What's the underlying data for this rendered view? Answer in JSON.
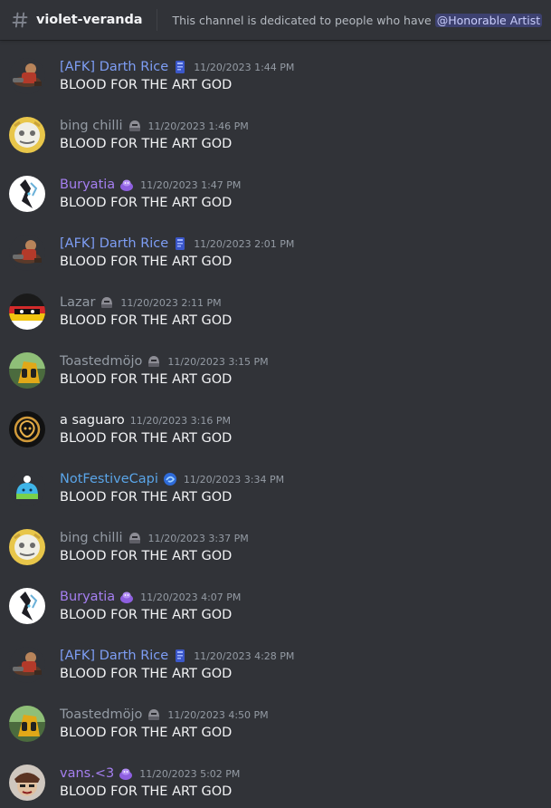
{
  "channel": {
    "name": "violet-veranda",
    "topic_prefix": "This channel is dedicated to people who have ",
    "topic_mention": "@Honorable Artist"
  },
  "colors": {
    "blue": "#7e9ef5",
    "gray": "#949ba4",
    "purple": "#a57ff0",
    "white": "#f2f3f5",
    "teal": "#5aa5e8"
  },
  "messages": [
    {
      "author": "[AFK] Darth Rice",
      "color": "#7e9ef5",
      "role_icon": "blue-book-icon",
      "avatar": "darth-rice-avatar",
      "timestamp": "11/20/2023 1:44 PM",
      "text": "BLOOD FOR THE ART GOD"
    },
    {
      "author": "bing chilli",
      "color": "#949ba4",
      "role_icon": "gray-helmet-icon",
      "avatar": "bing-chilli-avatar",
      "timestamp": "11/20/2023 1:46 PM",
      "text": "BLOOD FOR THE ART GOD"
    },
    {
      "author": "Buryatia",
      "color": "#a57ff0",
      "role_icon": "purple-blob-icon",
      "avatar": "buryatia-avatar",
      "timestamp": "11/20/2023 1:47 PM",
      "text": "BLOOD FOR THE ART GOD"
    },
    {
      "author": "[AFK] Darth Rice",
      "color": "#7e9ef5",
      "role_icon": "blue-book-icon",
      "avatar": "darth-rice-avatar",
      "timestamp": "11/20/2023 2:01 PM",
      "text": "BLOOD FOR THE ART GOD"
    },
    {
      "author": "Lazar",
      "color": "#949ba4",
      "role_icon": "gray-helmet-icon",
      "avatar": "lazar-avatar",
      "timestamp": "11/20/2023 2:11 PM",
      "text": "BLOOD FOR THE ART GOD"
    },
    {
      "author": "Toastedmöjo",
      "color": "#949ba4",
      "role_icon": "gray-helmet-icon",
      "avatar": "toastedmojo-avatar",
      "timestamp": "11/20/2023 3:15 PM",
      "text": "BLOOD FOR THE ART GOD"
    },
    {
      "author": "a saguaro",
      "color": "#f2f3f5",
      "role_icon": "",
      "avatar": "saguaro-avatar",
      "timestamp": "11/20/2023 3:16 PM",
      "text": "BLOOD FOR THE ART GOD"
    },
    {
      "author": "NotFestiveCapi",
      "color": "#5aa5e8",
      "role_icon": "blue-swirl-icon",
      "avatar": "capi-avatar",
      "timestamp": "11/20/2023 3:34 PM",
      "text": "BLOOD FOR THE ART GOD"
    },
    {
      "author": "bing chilli",
      "color": "#949ba4",
      "role_icon": "gray-helmet-icon",
      "avatar": "bing-chilli-avatar",
      "timestamp": "11/20/2023 3:37 PM",
      "text": "BLOOD FOR THE ART GOD"
    },
    {
      "author": "Buryatia",
      "color": "#a57ff0",
      "role_icon": "purple-blob-icon",
      "avatar": "buryatia-avatar",
      "timestamp": "11/20/2023 4:07 PM",
      "text": "BLOOD FOR THE ART GOD"
    },
    {
      "author": "[AFK] Darth Rice",
      "color": "#7e9ef5",
      "role_icon": "blue-book-icon",
      "avatar": "darth-rice-avatar",
      "timestamp": "11/20/2023 4:28 PM",
      "text": "BLOOD FOR THE ART GOD"
    },
    {
      "author": "Toastedmöjo",
      "color": "#949ba4",
      "role_icon": "gray-helmet-icon",
      "avatar": "toastedmojo-avatar",
      "timestamp": "11/20/2023 4:50 PM",
      "text": "BLOOD FOR THE ART GOD"
    },
    {
      "author": "vans.<3",
      "color": "#a57ff0",
      "role_icon": "purple-blob-icon",
      "avatar": "vans-avatar",
      "timestamp": "11/20/2023 5:02 PM",
      "text": "BLOOD FOR THE ART GOD"
    }
  ]
}
